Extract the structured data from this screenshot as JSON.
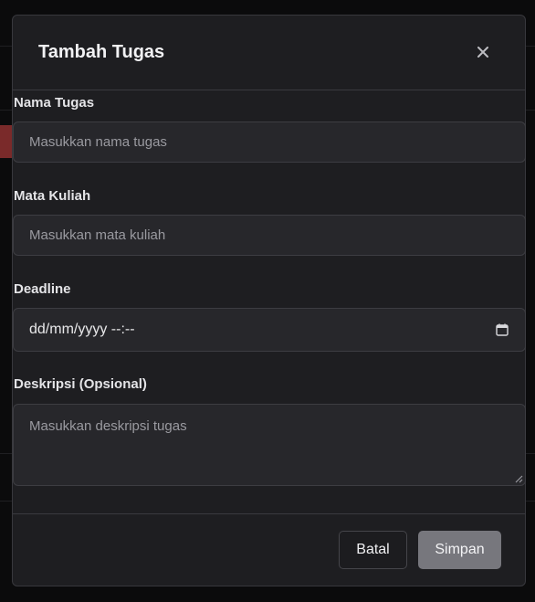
{
  "modal": {
    "title": "Tambah Tugas",
    "close_icon": "close-icon"
  },
  "form": {
    "nama_tugas": {
      "label": "Nama Tugas",
      "placeholder": "Masukkan nama tugas",
      "value": ""
    },
    "mata_kuliah": {
      "label": "Mata Kuliah",
      "placeholder": "Masukkan mata kuliah",
      "value": ""
    },
    "deadline": {
      "label": "Deadline",
      "display": "dd/mm/yyyy --:--",
      "icon": "calendar-icon"
    },
    "deskripsi": {
      "label": "Deskripsi (Opsional)",
      "placeholder": "Masukkan deskripsi tugas",
      "value": ""
    }
  },
  "footer": {
    "cancel_label": "Batal",
    "save_label": "Simpan"
  },
  "colors": {
    "modal_bg": "#1e1e21",
    "input_bg": "#27272b",
    "save_button_bg": "#77777d",
    "backdrop": "#0b0b0c"
  }
}
